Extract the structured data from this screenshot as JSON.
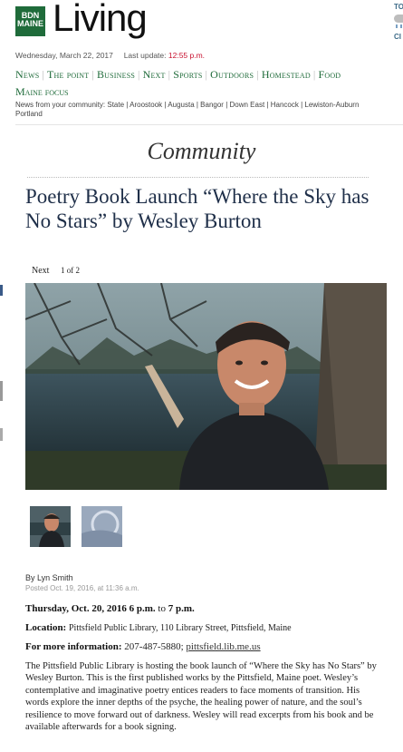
{
  "brand": {
    "logo_line1": "BDN",
    "logo_line2": "MAINE",
    "section_name": "Living"
  },
  "weather": {
    "line1": "TO",
    "line2": "CI"
  },
  "dateline": {
    "date": "Wednesday, March 22, 2017",
    "update_label": "Last update:",
    "update_time": "12:55 p.m."
  },
  "nav": {
    "items": [
      "News",
      "The point",
      "Business",
      "Next",
      "Sports",
      "Outdoors",
      "Homestead",
      "Food"
    ],
    "second_row": "Maine focus"
  },
  "community_nav": {
    "label": "News from your community:",
    "items": [
      "State",
      "Aroostook",
      "Augusta",
      "Bangor",
      "Down East",
      "Hancock",
      "Lewiston-Auburn"
    ],
    "overflow": "Portland"
  },
  "section_title": "Community",
  "article": {
    "headline": "Poetry Book Launch “Where the Sky has No Stars” by Wesley Burton",
    "pager": {
      "next_label": "Next",
      "count": "1 of 2"
    },
    "author": "By Lyn Smith",
    "posted": "Posted Oct. 19, 2016, at 11:36 a.m.",
    "when_label": "Thursday, Oct. 20, 2016 6 p.m.",
    "when_to": "to",
    "when_end": "7 p.m.",
    "location_label": "Location:",
    "location_value": "Pittsfield Public Library, 110 Library Street, Pittsfield, Maine",
    "info_label": "For more information:",
    "info_phone": "207-487-5880;",
    "info_link": "pittsfield.lib.me.us",
    "body": "The Pittsfield Public Library is hosting the book launch of “Where the Sky has No Stars” by Wesley Burton. This is the first published works by the Pittsfield, Maine poet. Wesley’s contemplative and imaginative poetry entices readers to face moments of transition. His words explore the inner depths of the psyche, the healing power of nature, and the soul’s resilience to move forward out of darkness. Wesley will read excerpts from his book and be available afterwards for a book signing."
  },
  "colors": {
    "brand_green": "#1f6b3a",
    "headline_navy": "#1f2f49",
    "update_red": "#c8102e"
  }
}
